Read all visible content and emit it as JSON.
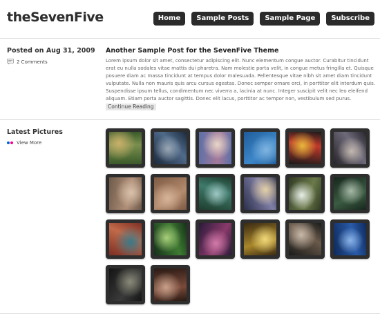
{
  "site": {
    "title": "theSevenFive"
  },
  "nav": [
    {
      "label": "Home"
    },
    {
      "label": "Sample Posts"
    },
    {
      "label": "Sample Page"
    },
    {
      "label": "Subscribe"
    }
  ],
  "post": {
    "date": "Posted on Aug 31, 2009",
    "comments": "2 Comments",
    "title": "Another Sample Post for the SevenFive Theme",
    "body": "Lorem ipsum dolor sit amet, consectetur adipiscing elit. Nunc elementum congue auctor. Curabitur tincidunt erat eu nulla sodales vitae mattis dui pharetra. Nam molestie porta velit, in congue metus fringilla et. Quisque posuere diam ac massa tincidunt at tempus dolor malesuada. Pellentesque vitae nibh sit amet diam tincidunt vulputate. Nulla non mauris quis arcu cursus egestas. Donec semper ornare orci, in porttitor elit interdum quis. Suspendisse ipsum tellus, condimentum nec viverra a, lacinia at nunc. Integer suscipit velit nec leo eleifend aliquam. Etiam porta auctor sagittis. Donec elit lacus, porttitor ac tempor non, vestibulum sed purus.",
    "continue": "Continue Reading"
  },
  "pictures": {
    "heading": "Latest Pictures",
    "view_more": "View More",
    "flickr_colors": [
      "#0063dc",
      "#ff0084"
    ],
    "photos": [
      {
        "name": "photo-green-boardwalk",
        "colors": [
          "#3a5a2a",
          "#7a8f4e",
          "#c9b06a"
        ]
      },
      {
        "name": "photo-urban-street",
        "colors": [
          "#1c2a3c",
          "#4f6a8a",
          "#9aa8b5"
        ]
      },
      {
        "name": "photo-victorian-house",
        "colors": [
          "#5b6fa8",
          "#a57a9a",
          "#e8d6c8"
        ]
      },
      {
        "name": "photo-sea-rock",
        "colors": [
          "#1f5c9a",
          "#3c86c8",
          "#7fb4e0"
        ]
      },
      {
        "name": "photo-colorful-flags",
        "colors": [
          "#1a1a1a",
          "#c2392b",
          "#e6b83a"
        ]
      },
      {
        "name": "photo-sunset-beach",
        "colors": [
          "#27252b",
          "#6f6a7a",
          "#c2b8b0"
        ]
      },
      {
        "name": "photo-dry-leaves",
        "colors": [
          "#6e5a4a",
          "#b08f78",
          "#d9c1aa"
        ]
      },
      {
        "name": "photo-cracked-earth",
        "colors": [
          "#7d5a44",
          "#b38a6c",
          "#d6b398"
        ]
      },
      {
        "name": "photo-palm-tree",
        "colors": [
          "#1e3d2e",
          "#3e7a6a",
          "#9fc7c4"
        ]
      },
      {
        "name": "photo-crowd-dusk",
        "colors": [
          "#2b2f4a",
          "#7f7ea6",
          "#e3cfa6"
        ]
      },
      {
        "name": "photo-waterfall",
        "colors": [
          "#2f3a22",
          "#6b7a4a",
          "#e8efe8"
        ]
      },
      {
        "name": "photo-tree-branches",
        "colors": [
          "#16261c",
          "#3b5b42",
          "#a7b9a8"
        ]
      },
      {
        "name": "photo-canal-houses",
        "colors": [
          "#7a2f24",
          "#c26a4a",
          "#3a7a8a"
        ]
      },
      {
        "name": "photo-ferns",
        "colors": [
          "#15301a",
          "#3f7a32",
          "#a8d07a"
        ]
      },
      {
        "name": "photo-purple-flowers",
        "colors": [
          "#2a1a3a",
          "#8a3a6a",
          "#d07aa8"
        ]
      },
      {
        "name": "photo-golden-building",
        "colors": [
          "#3a2a12",
          "#a8862a",
          "#f0d87a"
        ]
      },
      {
        "name": "photo-portrait-sunglasses",
        "colors": [
          "#1a1a1a",
          "#6a5a4a",
          "#c8b8a8"
        ]
      },
      {
        "name": "photo-blue-skyscraper",
        "colors": [
          "#0e2a5a",
          "#2a5aa8",
          "#8ab4e8"
        ]
      },
      {
        "name": "photo-dark-building",
        "colors": [
          "#141414",
          "#3a3a3a",
          "#8a8a7a"
        ]
      },
      {
        "name": "photo-bicycles",
        "colors": [
          "#2a1a14",
          "#7a4a3a",
          "#c8a08a"
        ]
      }
    ]
  }
}
